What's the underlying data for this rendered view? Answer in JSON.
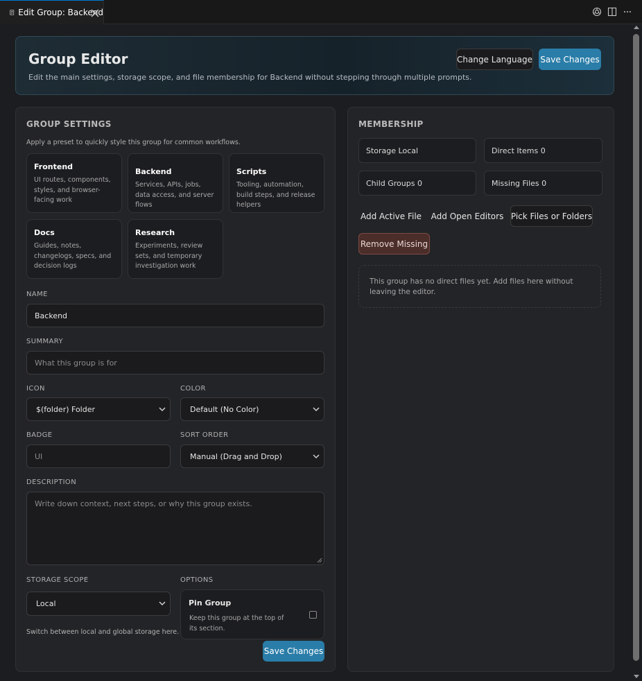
{
  "tab": {
    "title": "Edit Group: Backend"
  },
  "header": {
    "title": "Group Editor",
    "subtitle": "Edit the main settings, storage scope, and file membership for Backend without stepping through multiple prompts.",
    "change_language": "Change Language",
    "save": "Save Changes"
  },
  "settings": {
    "title": "GROUP SETTINGS",
    "preset_hint": "Apply a preset to quickly style this group for common workflows.",
    "presets": [
      {
        "name": "Frontend",
        "desc": "UI routes, components, styles, and browser-facing work"
      },
      {
        "name": "Backend",
        "desc": "Services, APIs, jobs, data access, and server flows"
      },
      {
        "name": "Scripts",
        "desc": "Tooling, automation, build steps, and release helpers"
      },
      {
        "name": "Docs",
        "desc": "Guides, notes, changelogs, specs, and decision logs"
      },
      {
        "name": "Research",
        "desc": "Experiments, review sets, and temporary investigation work"
      }
    ],
    "name_label": "NAME",
    "name_value": "Backend",
    "summary_label": "SUMMARY",
    "summary_placeholder": "What this group is for",
    "icon_label": "ICON",
    "icon_value": "$(folder) Folder",
    "color_label": "COLOR",
    "color_value": "Default (No Color)",
    "badge_label": "BADGE",
    "badge_placeholder": "UI",
    "sort_label": "SORT ORDER",
    "sort_value": "Manual (Drag and Drop)",
    "description_label": "DESCRIPTION",
    "description_placeholder": "Write down context, next steps, or why this group exists.",
    "scope_label": "STORAGE SCOPE",
    "scope_value": "Local",
    "scope_hint": "Switch between local and global storage here.",
    "options_label": "OPTIONS",
    "pin_title": "Pin Group",
    "pin_desc": "Keep this group at the top of its section.",
    "pin_checked": false,
    "save": "Save Changes"
  },
  "membership": {
    "title": "MEMBERSHIP",
    "storage": "Storage Local",
    "direct_items": "Direct Items 0",
    "child_groups": "Child Groups 0",
    "missing_files": "Missing Files 0",
    "add_active": "Add Active File",
    "add_open": "Add Open Editors",
    "pick": "Pick Files or Folders",
    "remove_missing": "Remove Missing",
    "empty": "This group has no direct files yet. Add files here without leaving the editor."
  },
  "colors": {
    "accent": "#2a7da8",
    "danger_bg": "#4b2d2a",
    "tab_active_border": "#0078d4"
  }
}
